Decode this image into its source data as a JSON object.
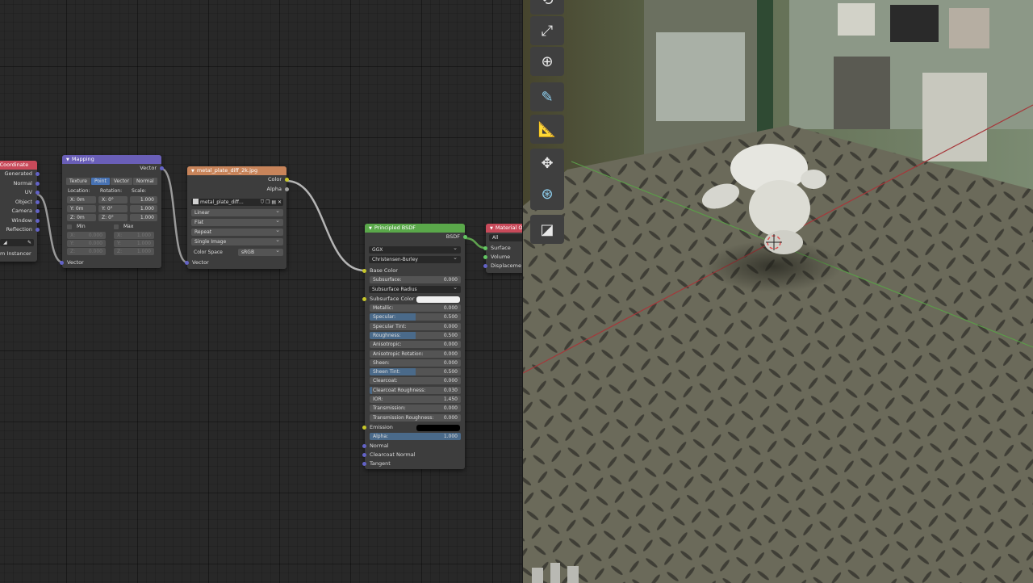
{
  "node_editor": {
    "tex_coord": {
      "title": "re Coordinate",
      "outputs": [
        "Generated",
        "Normal",
        "UV",
        "Object",
        "Camera",
        "Window",
        "Reflection"
      ],
      "footer": "m Instancer"
    },
    "mapping": {
      "title": "Mapping",
      "output": "Vector",
      "tabs": [
        "Texture",
        "Point",
        "Vector",
        "Normal"
      ],
      "col_headers": [
        "Location:",
        "Rotation:",
        "Scale:"
      ],
      "rows": [
        {
          "axis": "X:",
          "loc": "0m",
          "rot": "0°",
          "scale": "1.000"
        },
        {
          "axis": "Y:",
          "loc": "0m",
          "rot": "0°",
          "scale": "1.000"
        },
        {
          "axis": "Z:",
          "loc": "0m",
          "rot": "0°",
          "scale": "1.000"
        }
      ],
      "min_label": "Min",
      "max_label": "Max",
      "minmax_rows": [
        {
          "ax": "X:",
          "min": "0.000",
          "ax2": "X:",
          "max": "1.000"
        },
        {
          "ax": "Y:",
          "min": "0.000",
          "ax2": "Y:",
          "max": "1.000"
        },
        {
          "ax": "Z:",
          "min": "0.000",
          "ax2": "Z:",
          "max": "1.000"
        }
      ],
      "input": "Vector"
    },
    "image_tex": {
      "title": "metal_plate_diff_2k.jpg",
      "outputs": [
        "Color",
        "Alpha"
      ],
      "image_name": "metal_plate_diff...",
      "interpolation": "Linear",
      "projection": "Flat",
      "extension": "Repeat",
      "source": "Single Image",
      "color_space_label": "Color Space",
      "color_space": "sRGB",
      "input": "Vector"
    },
    "bsdf": {
      "title": "Principled BSDF",
      "output": "BSDF",
      "distribution": "GGX",
      "subsurface_method": "Christensen-Burley",
      "base_color": "Base Color",
      "subsurface": {
        "label": "Subsurface:",
        "value": "0.000"
      },
      "subsurface_radius": "Subsurface Radius",
      "subsurface_color": "Subsurface Color",
      "params": [
        {
          "label": "Metallic:",
          "value": "0.000",
          "fill": 0
        },
        {
          "label": "Specular:",
          "value": "0.500",
          "fill": 0.5
        },
        {
          "label": "Specular Tint:",
          "value": "0.000",
          "fill": 0
        },
        {
          "label": "Roughness:",
          "value": "0.500",
          "fill": 0.5
        },
        {
          "label": "Anisotropic:",
          "value": "0.000",
          "fill": 0
        },
        {
          "label": "Anisotropic Rotation:",
          "value": "0.000",
          "fill": 0
        },
        {
          "label": "Sheen:",
          "value": "0.000",
          "fill": 0
        },
        {
          "label": "Sheen Tint:",
          "value": "0.500",
          "fill": 0.5
        },
        {
          "label": "Clearcoat:",
          "value": "0.000",
          "fill": 0
        },
        {
          "label": "Clearcoat Roughness:",
          "value": "0.030",
          "fill": 0.03
        },
        {
          "label": "IOR:",
          "value": "1.450",
          "fill": 0
        },
        {
          "label": "Transmission:",
          "value": "0.000",
          "fill": 0
        },
        {
          "label": "Transmission Roughness:",
          "value": "0.000",
          "fill": 0
        }
      ],
      "emission": "Emission",
      "alpha": {
        "label": "Alpha:",
        "value": "1.000",
        "fill": 1
      },
      "vector_inputs": [
        "Normal",
        "Clearcoat Normal",
        "Tangent"
      ]
    },
    "material_output": {
      "title": "Material Ou",
      "target": "All",
      "inputs": [
        "Surface",
        "Volume",
        "Displaceme"
      ]
    }
  },
  "colors": {
    "input_header": "#c84a5a",
    "vector_header": "#6a5fb8",
    "texture_header": "#c8845a",
    "shader_header": "#5aa84a",
    "output_header": "#c84a5a"
  },
  "viewport": {
    "tools": [
      "rotate-icon",
      "scale-icon",
      "transform-icon",
      "annotate-icon",
      "measure-icon",
      "move-view-icon",
      "orbit-view-icon",
      "add-cube-icon"
    ]
  }
}
